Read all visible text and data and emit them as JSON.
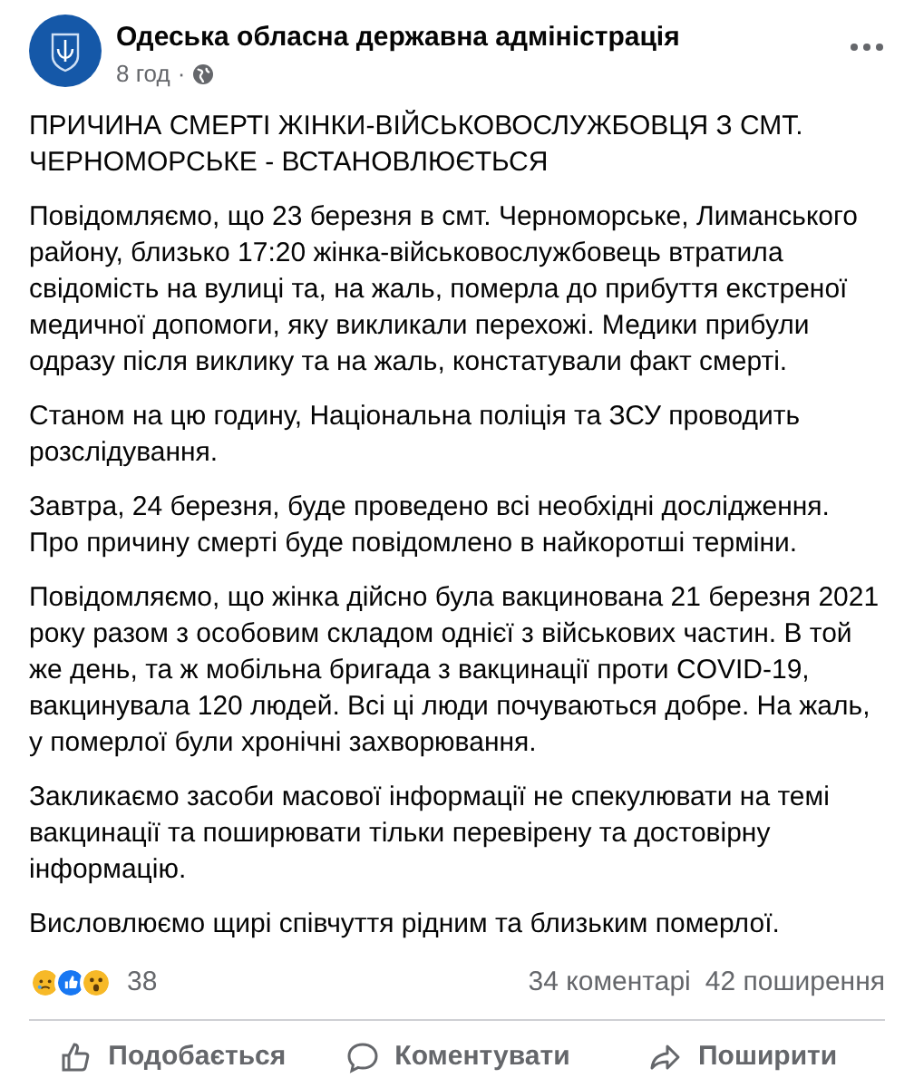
{
  "post": {
    "author": "Одеська обласна державна адміністрація",
    "time": "8 год",
    "separator": "·",
    "title": "ПРИЧИНА СМЕРТІ ЖІНКИ-ВІЙСЬКОВОСЛУЖБОВЦЯ З СМТ. ЧЕРНОМОРСЬКЕ - ВСТАНОВЛЮЄТЬСЯ",
    "paragraphs": [
      "Повідомляємо, що 23 березня в смт. Черноморське, Лиманського району, близько 17:20 жінка-військовослужбовець втратила свідомість на вулиці та, на жаль, померла до прибуття екстреної медичної допомоги, яку викликали перехожі. Медики прибули одразу після виклику та на жаль, констатували факт смерті.",
      "Станом на цю годину, Національна поліція та ЗСУ проводить розслідування.",
      "Завтра, 24 березня, буде проведено всі необхідні дослідження. Про причину смерті буде повідомлено в найкоротші терміни.",
      "Повідомляємо, що жінка дійсно була вакцинована 21 березня 2021 року разом з особовим складом однієї з військових частин. В той же день, та ж мобільна бригада з вакцинації проти COVID-19, вакцинувала 120 людей. Всі ці люди почуваються добре. На жаль, у померлої були хронічні захворювання.",
      "Закликаємо засоби масової інформації не спекулювати на темі вакцинації та поширювати тільки перевірену та достовірну інформацію.",
      "Висловлюємо щирі співчуття рідним та близьким померлої."
    ]
  },
  "reactions": {
    "types": [
      {
        "kind": "sad"
      },
      {
        "kind": "like"
      },
      {
        "kind": "wow"
      }
    ],
    "count": "38",
    "comments": "34 коментарі",
    "shares": "42 поширення"
  },
  "actions": [
    {
      "kind": "like",
      "label": "Подобається"
    },
    {
      "kind": "comment",
      "label": "Коментувати"
    },
    {
      "kind": "share",
      "label": "Поширити"
    }
  ]
}
